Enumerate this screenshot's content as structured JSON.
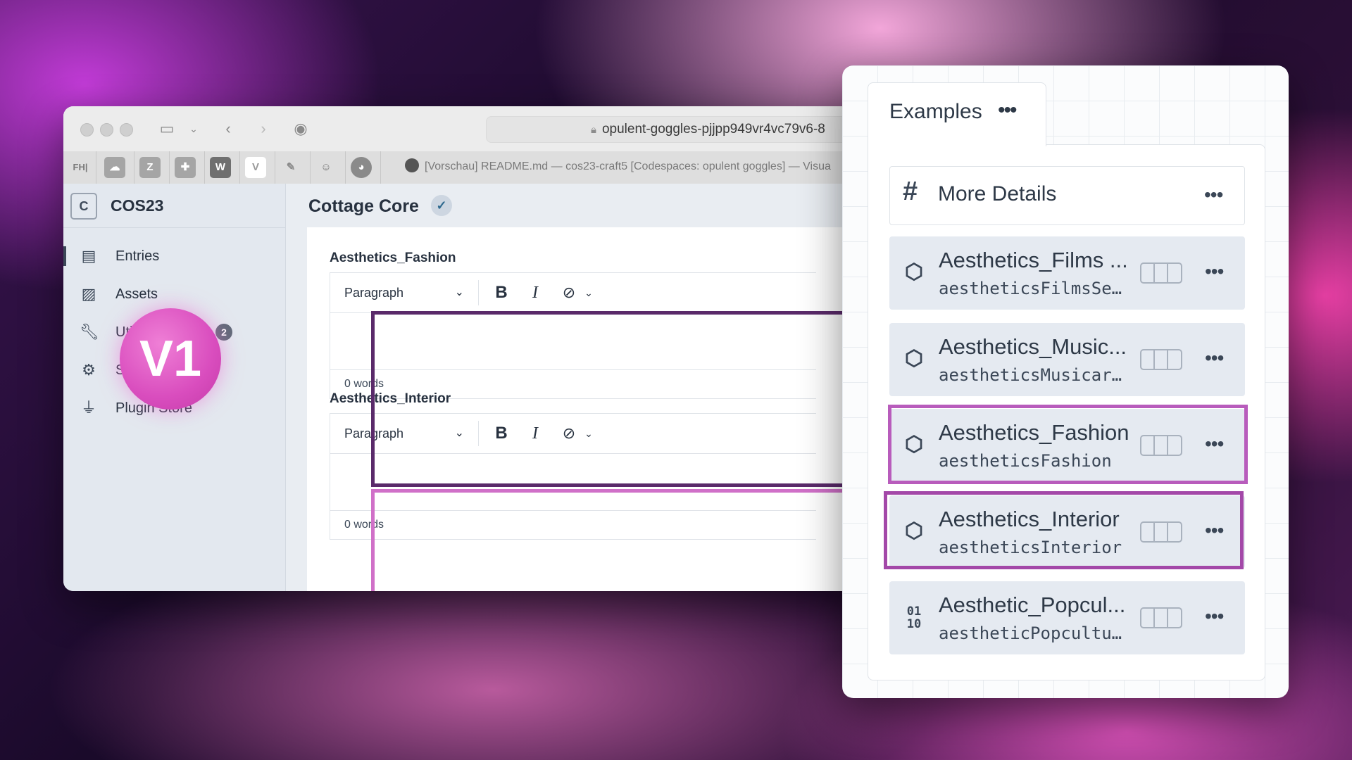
{
  "browser": {
    "url": "opulent-goggles-pjjpp949vr4vc79v6-8",
    "active_tab": "[Vorschau] README.md — cos23-craft5 [Codespaces: opulent goggles] — Visua",
    "favicons": [
      "FH|",
      "",
      "Z",
      "",
      "W",
      "V",
      "",
      "",
      ""
    ]
  },
  "sidebar": {
    "logo_letter": "C",
    "site_name": "COS23",
    "items": [
      {
        "label": "Entries",
        "icon": "entries-icon"
      },
      {
        "label": "Assets",
        "icon": "image-icon"
      },
      {
        "label": "Utilities",
        "icon": "wrench-icon",
        "badge": "2"
      },
      {
        "label": "Settings",
        "icon": "gear-icon"
      },
      {
        "label": "Plugin Store",
        "icon": "plug-icon"
      }
    ]
  },
  "main": {
    "title": "Cottage Core",
    "fields": [
      {
        "label": "Aesthetics_Fashion",
        "format": "Paragraph",
        "word_count": "0 words"
      },
      {
        "label": "Aesthetics_Interior",
        "format": "Paragraph",
        "word_count": "0 words"
      }
    ]
  },
  "overlay_badge": "V1",
  "panel": {
    "tab_label": "Examples",
    "heading": "More Details",
    "fields": [
      {
        "name": "Aesthetics_Films ...",
        "handle": "aestheticsFilmsSe…",
        "icon": "entries-field-icon"
      },
      {
        "name": "Aesthetics_Music...",
        "handle": "aestheticsMusicar…",
        "icon": "entries-field-icon"
      },
      {
        "name": "Aesthetics_Fashion",
        "handle": "aestheticsFashion",
        "icon": "entries-field-icon"
      },
      {
        "name": "Aesthetics_Interior",
        "handle": "aestheticsInterior",
        "icon": "entries-field-icon"
      },
      {
        "name": "Aesthetic_Popcul...",
        "handle": "aestheticPopcultu…",
        "icon": "binary-icon"
      }
    ]
  },
  "colors": {
    "highlight_dark": "#5a2a6a",
    "highlight_pink": "#d070c8",
    "highlight_mid": "#b85cbc"
  }
}
